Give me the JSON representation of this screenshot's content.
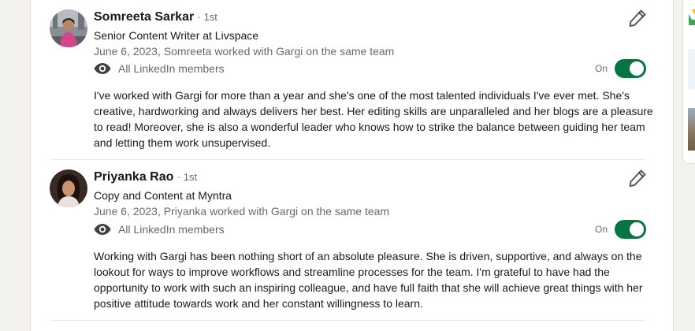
{
  "recommendations": [
    {
      "name": "Somreeta Sarkar",
      "degree": "· 1st",
      "headline": "Senior Content Writer at Livspace",
      "meta": "June 6, 2023, Somreeta worked with Gargi on the same team",
      "visibility": "All LinkedIn members",
      "toggle_label": "On",
      "toggle_on": true,
      "text": "I've worked with Gargi for more than a year and she's one of the most talented individuals I've ever met. She's creative, hardworking and always delivers her best. Her editing skills are unparalleled and her blogs are a pleasure to read! Moreover, she is also a wonderful leader who knows how to strike the balance between guiding her team and letting them work unsupervised."
    },
    {
      "name": "Priyanka Rao",
      "degree": "· 1st",
      "headline": "Copy and Content at Myntra",
      "meta": "June 6, 2023, Priyanka worked with Gargi on the same team",
      "visibility": "All LinkedIn members",
      "toggle_label": "On",
      "toggle_on": true,
      "text": "Working with Gargi has been nothing short of an absolute pleasure. She is driven, supportive, and always on the lookout for ways to improve workflows and streamline processes for the team. I'm grateful to have had the opportunity to work with such an inspiring colleague, and have full faith that she will achieve great things with her positive attitude towards work and her constant willingness to learn."
    }
  ],
  "icons": {
    "visibility": "eye-icon",
    "edit": "pencil-icon"
  },
  "colors": {
    "toggle_on": "#057642",
    "page_bg": "#f3f2ef"
  }
}
